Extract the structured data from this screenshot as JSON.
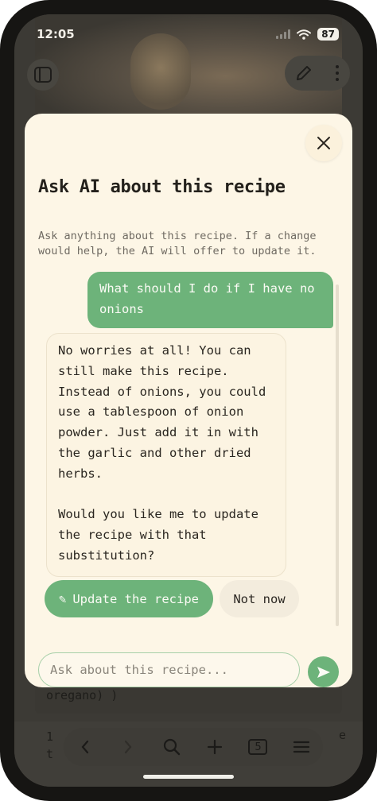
{
  "status_bar": {
    "time": "12:05",
    "battery": "87"
  },
  "background": {
    "ingredient_fragment": "oregano) )",
    "step_fragment_1": "1",
    "step_fragment_2": "t",
    "step_fragment_end": "e",
    "bottom_bar": {
      "tab_count": "5"
    }
  },
  "sheet": {
    "title": "Ask AI about this recipe",
    "subtitle": "Ask anything about this recipe. If a change would help, the AI will offer to update it.",
    "messages": [
      {
        "role": "user",
        "text": "What should I do if I have no onions"
      },
      {
        "role": "assistant",
        "text": "No worries at all! You can still make this recipe. Instead of onions, you could use a tablespoon of onion powder. Just add it in with the garlic and other dried herbs.\n\nWould you like me to update the recipe with that substitution?"
      }
    ],
    "actions": {
      "update_icon": "✎",
      "update_label": "Update the recipe",
      "dismiss_label": "Not now"
    },
    "input": {
      "placeholder": "Ask about this recipe...",
      "value": ""
    },
    "icons": {
      "close": "close-icon",
      "send": "send-icon",
      "edit": "pencil-icon"
    }
  },
  "colors": {
    "accent": "#6db37a",
    "sheet_bg": "#fdf6e6",
    "title": "#24211c"
  }
}
